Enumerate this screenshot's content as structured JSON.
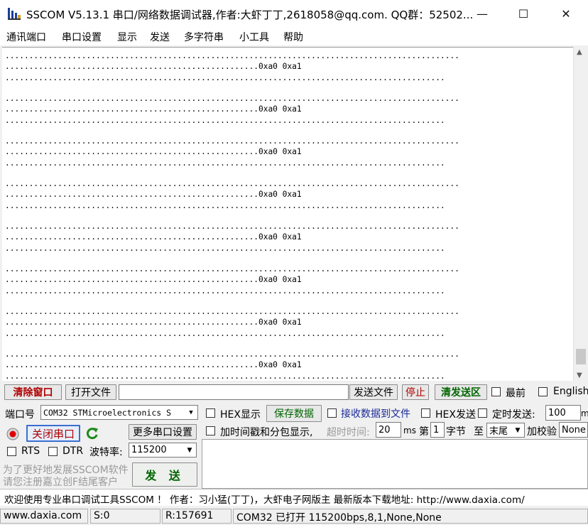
{
  "window": {
    "title": "SSCOM V5.13.1 串口/网络数据调试器,作者:大虾丁丁,2618058@qq.com. QQ群：52502...",
    "app_icon": "sscom-logo-icon",
    "min": "—",
    "max": "☐",
    "close": "✕"
  },
  "menu": [
    "通讯端口",
    "串口设置",
    "显示",
    "发送",
    "多字符串",
    "小工具",
    "帮助"
  ],
  "receive": {
    "dots_line": "...............................................................................................",
    "data_line": ".....................................................0xa0 0xa1",
    "tail_line": "............................................................................................"
  },
  "toolbar": {
    "clear_window": "清除窗口",
    "open_file": "打开文件",
    "file_path": "",
    "send_file": "发送文件",
    "stop": "停止",
    "clear_send_area": "清发送区",
    "last": "最前",
    "english": "English"
  },
  "port": {
    "port_label": "端口号",
    "port_value": "COM32 STMicroelectronics S",
    "close_port": "关闭串口",
    "more_settings": "更多串口设置",
    "rts": "RTS",
    "dtr": "DTR",
    "baud_label": "波特率:",
    "baud_value": "115200"
  },
  "options": {
    "hex_display": "HEX显示",
    "save_data": "保存数据",
    "recv_to_file": "接收数据到文件",
    "hex_send": "HEX发送",
    "timed_send": "定时发送:",
    "timed_value": "100",
    "timed_unit": "ms/次",
    "add_timestamp": "加时间戳和分包显示,",
    "timeout_label": "超时时间:",
    "timeout_value": "20",
    "timeout_unit": "ms",
    "byte_prefix": "第",
    "byte_index": "1",
    "byte_suffix": "字节",
    "to_label": "至",
    "end_value": "末尾",
    "checksum_label": "加校验",
    "checksum_value": "None"
  },
  "promo": {
    "line1": "为了更好地发展SSCOM软件",
    "line2": "请您注册嘉立创F结尾客户",
    "send": "发 送"
  },
  "notice": "欢迎使用专业串口调试工具SSCOM ！  作者：习小猛(丁丁)，大虾电子网版主  最新版本下载地址: http://www.daxia.com/",
  "status": {
    "site": "www.daxia.com",
    "sent": "S:0",
    "received": "R:157691",
    "port_info": "COM32 已打开  115200bps,8,1,None,None"
  }
}
